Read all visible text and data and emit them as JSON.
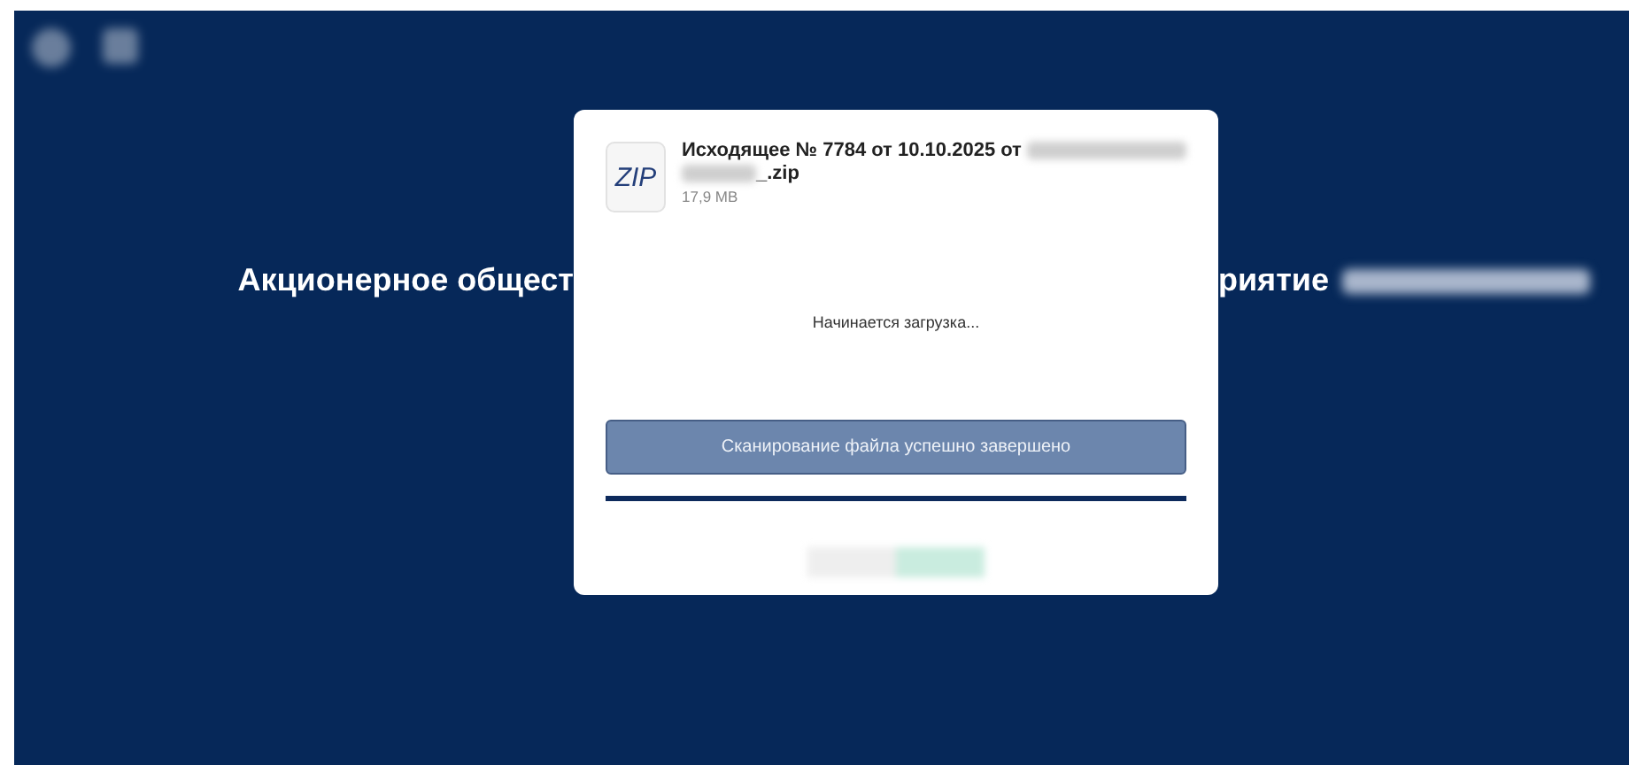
{
  "background": {
    "heading_left": "Акционерное общест",
    "heading_right": "риятие"
  },
  "dialog": {
    "file": {
      "type_label": "ZIP",
      "name_start": "Исходящее № 7784 от 10.10.2025 от",
      "name_end": "_.zip",
      "size": "17,9 MB"
    },
    "status": "Начинается загрузка...",
    "scan_button": "Сканирование файла успешно завершено"
  }
}
